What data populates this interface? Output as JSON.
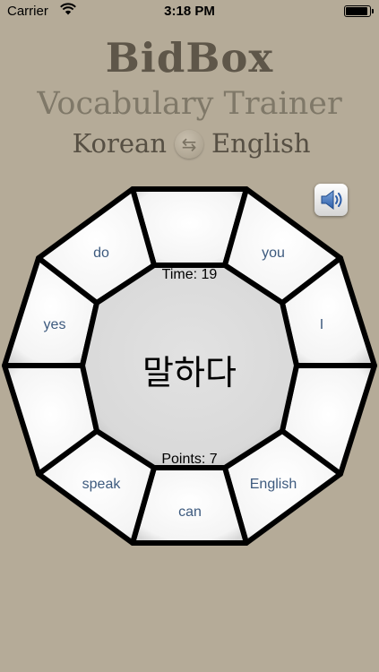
{
  "status_bar": {
    "carrier": "Carrier",
    "time": "3:18 PM",
    "wifi_icon": "wifi-icon",
    "battery_icon": "battery-icon"
  },
  "header": {
    "title": "BidBox",
    "subtitle": "Vocabulary Trainer",
    "source_language": "Korean",
    "target_language": "English",
    "swap_icon": "swap-arrows-icon"
  },
  "speaker_button": {
    "icon": "speaker-icon"
  },
  "game": {
    "time_label": "Time: 19",
    "points_label": "Points: 7",
    "target_word": "말하다",
    "answers": {
      "top": "",
      "top_right": "you",
      "right_upper": "I",
      "right_lower": "",
      "bottom_right": "English",
      "bottom": "can",
      "bottom_left": "speak",
      "left_lower": "",
      "left_upper": "yes",
      "top_left": "do"
    }
  },
  "colors": {
    "background": "#b5ab98",
    "title": "#5e5649",
    "subtitle": "#7f7868",
    "answer_text": "#3d5a7e",
    "tile_outline": "#000000"
  }
}
